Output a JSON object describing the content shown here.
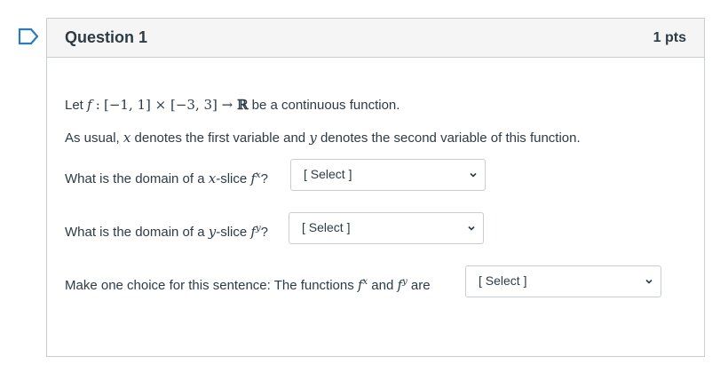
{
  "question": {
    "title": "Question 1",
    "points": "1 pts"
  },
  "body": {
    "intro": {
      "prefix": "Let",
      "func": "f",
      "colon": ":",
      "domain": "[−1, 1] × [−3, 3] → ",
      "codomain": "ℝ",
      "suffix": " be a continuous function."
    },
    "usual": {
      "p1": "As usual, ",
      "x": "x",
      "p2": " denotes the first variable and ",
      "y": "y",
      "p3": " denotes the second variable of this function."
    },
    "q1": {
      "p1": "What is the domain of a ",
      "x": "x",
      "p2": "-slice ",
      "f": "f",
      "sup": "x",
      "p3": "?"
    },
    "q2": {
      "p1": "What is the domain of a ",
      "y": "y",
      "p2": "-slice ",
      "f": "f",
      "sup": "y",
      "p3": "?"
    },
    "q3": {
      "p1": "Make one choice for this sentence: The functions ",
      "f1": "f",
      "sup1": "x",
      "and": " and ",
      "f2": "f",
      "sup2": "y",
      "p2": " are"
    }
  },
  "selects": {
    "s1": "[ Select ]",
    "s2": "[ Select ]",
    "s3": "[ Select ]"
  }
}
